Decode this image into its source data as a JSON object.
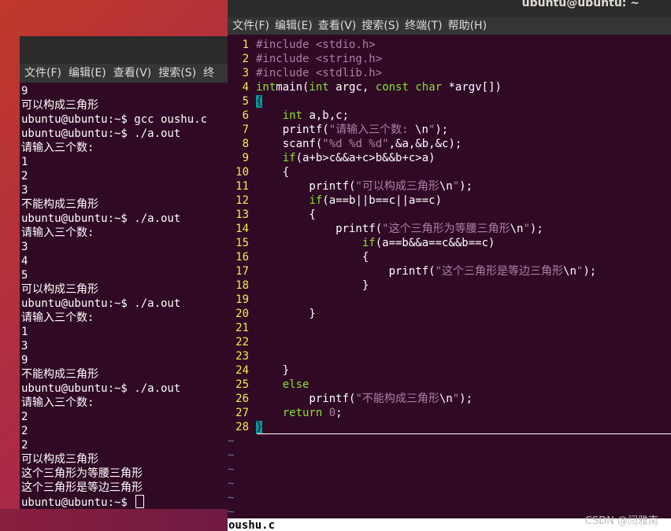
{
  "right_window": {
    "title": "ubuntu@ubuntu: ~",
    "menu": [
      "文件(F)",
      "编辑(E)",
      "查看(V)",
      "搜索(S)",
      "终端(T)",
      "帮助(H)"
    ],
    "filename": "oushu.c",
    "code": [
      {
        "n": "1",
        "tokens": [
          [
            "pp",
            "#include "
          ],
          [
            "str",
            "<stdio.h>"
          ]
        ]
      },
      {
        "n": "2",
        "tokens": [
          [
            "pp",
            "#include "
          ],
          [
            "str",
            "<string.h>"
          ]
        ]
      },
      {
        "n": "3",
        "tokens": [
          [
            "pp",
            "#include "
          ],
          [
            "str",
            "<stdlib.h>"
          ]
        ]
      },
      {
        "n": "4",
        "tokens": [
          [
            "kw",
            "int"
          ],
          [
            "",
            "main("
          ],
          [
            "kw",
            "int"
          ],
          [
            "",
            " argc, "
          ],
          [
            "kw",
            "const char"
          ],
          [
            "",
            " *argv[])"
          ]
        ]
      },
      {
        "n": "5",
        "tokens": [
          [
            "cur",
            "{"
          ]
        ]
      },
      {
        "n": "6",
        "tokens": [
          [
            "",
            "    "
          ],
          [
            "kw",
            "int"
          ],
          [
            "",
            " a,b,c;"
          ]
        ]
      },
      {
        "n": "7",
        "tokens": [
          [
            "",
            "    printf("
          ],
          [
            "str",
            "\"请输入三个数: "
          ],
          [
            "esc",
            "\\n"
          ],
          [
            "str",
            "\""
          ],
          [
            "",
            ");"
          ]
        ]
      },
      {
        "n": "8",
        "tokens": [
          [
            "",
            "    scanf("
          ],
          [
            "str",
            "\"%d %d %d\""
          ],
          [
            "",
            ",&a,&b,&c);"
          ]
        ]
      },
      {
        "n": "9",
        "tokens": [
          [
            "",
            "    "
          ],
          [
            "kw",
            "if"
          ],
          [
            "",
            "(a+b>c&&a+c>b&&b+c>a)"
          ]
        ]
      },
      {
        "n": "10",
        "tokens": [
          [
            "",
            "    {"
          ]
        ]
      },
      {
        "n": "11",
        "tokens": [
          [
            "",
            "        printf("
          ],
          [
            "str",
            "\"可以构成三角形"
          ],
          [
            "esc",
            "\\n"
          ],
          [
            "str",
            "\""
          ],
          [
            "",
            ");"
          ]
        ]
      },
      {
        "n": "12",
        "tokens": [
          [
            "",
            "        "
          ],
          [
            "kw",
            "if"
          ],
          [
            "",
            "(a==b||b==c||a==c)"
          ]
        ]
      },
      {
        "n": "13",
        "tokens": [
          [
            "",
            "        {"
          ]
        ]
      },
      {
        "n": "14",
        "tokens": [
          [
            "",
            "            printf("
          ],
          [
            "str",
            "\"这个三角形为等腰三角形"
          ],
          [
            "esc",
            "\\n"
          ],
          [
            "str",
            "\""
          ],
          [
            "",
            ");"
          ]
        ]
      },
      {
        "n": "15",
        "tokens": [
          [
            "",
            "                "
          ],
          [
            "kw",
            "if"
          ],
          [
            "",
            "(a==b&&a==c&&b==c)"
          ]
        ]
      },
      {
        "n": "16",
        "tokens": [
          [
            "",
            "                {"
          ]
        ]
      },
      {
        "n": "17",
        "tokens": [
          [
            "",
            "                    printf("
          ],
          [
            "str",
            "\"这个三角形是等边三角形"
          ],
          [
            "esc",
            "\\n"
          ],
          [
            "str",
            "\""
          ],
          [
            "",
            ");"
          ]
        ]
      },
      {
        "n": "18",
        "tokens": [
          [
            "",
            "                }"
          ]
        ]
      },
      {
        "n": "19",
        "tokens": []
      },
      {
        "n": "20",
        "tokens": [
          [
            "",
            "        }"
          ]
        ]
      },
      {
        "n": "21",
        "tokens": []
      },
      {
        "n": "22",
        "tokens": []
      },
      {
        "n": "23",
        "tokens": []
      },
      {
        "n": "24",
        "tokens": [
          [
            "",
            "    }"
          ]
        ]
      },
      {
        "n": "25",
        "tokens": [
          [
            "",
            "    "
          ],
          [
            "kw",
            "else"
          ]
        ]
      },
      {
        "n": "26",
        "tokens": [
          [
            "",
            "        printf("
          ],
          [
            "str",
            "\"不能构成三角形"
          ],
          [
            "esc",
            "\\n"
          ],
          [
            "str",
            "\""
          ],
          [
            "",
            ");"
          ]
        ]
      },
      {
        "n": "27",
        "tokens": [
          [
            "",
            "    "
          ],
          [
            "kw",
            "return"
          ],
          [
            "",
            " "
          ],
          [
            "num",
            "0"
          ],
          [
            "",
            ";"
          ]
        ]
      },
      {
        "n": "28",
        "tokens": [
          [
            "cur",
            "}"
          ]
        ]
      }
    ],
    "tildes": [
      "~",
      "~",
      "~",
      "~",
      "~",
      "~"
    ]
  },
  "left_window": {
    "menu": [
      "文件(F)",
      "编辑(E)",
      "查看(V)",
      "搜索(S)",
      "终"
    ],
    "lines": [
      "9",
      "可以构成三角形",
      "ubuntu@ubuntu:~$ gcc oushu.c",
      "ubuntu@ubuntu:~$ ./a.out",
      "请输入三个数:",
      "1",
      "2",
      "3",
      "不能构成三角形",
      "ubuntu@ubuntu:~$ ./a.out",
      "请输入三个数:",
      "3",
      "4",
      "5",
      "可以构成三角形",
      "ubuntu@ubuntu:~$ ./a.out",
      "请输入三个数:",
      "1",
      "3",
      "9",
      "不能构成三角形",
      "ubuntu@ubuntu:~$ ./a.out",
      "请输入三个数:",
      "2",
      "2",
      "2",
      "可以构成三角形",
      "这个三角形为等腰三角形",
      "这个三角形是等边三角形",
      "ubuntu@ubuntu:~$ "
    ]
  },
  "watermark": "CSDN @闫雅南",
  "colors": {
    "terminal_bg": "#300a24",
    "line_number": "#fce94f",
    "keyword": "#8ae234",
    "string": "#ad7fa8",
    "tilde": "#6a76b0",
    "cursor": "#06989a"
  }
}
